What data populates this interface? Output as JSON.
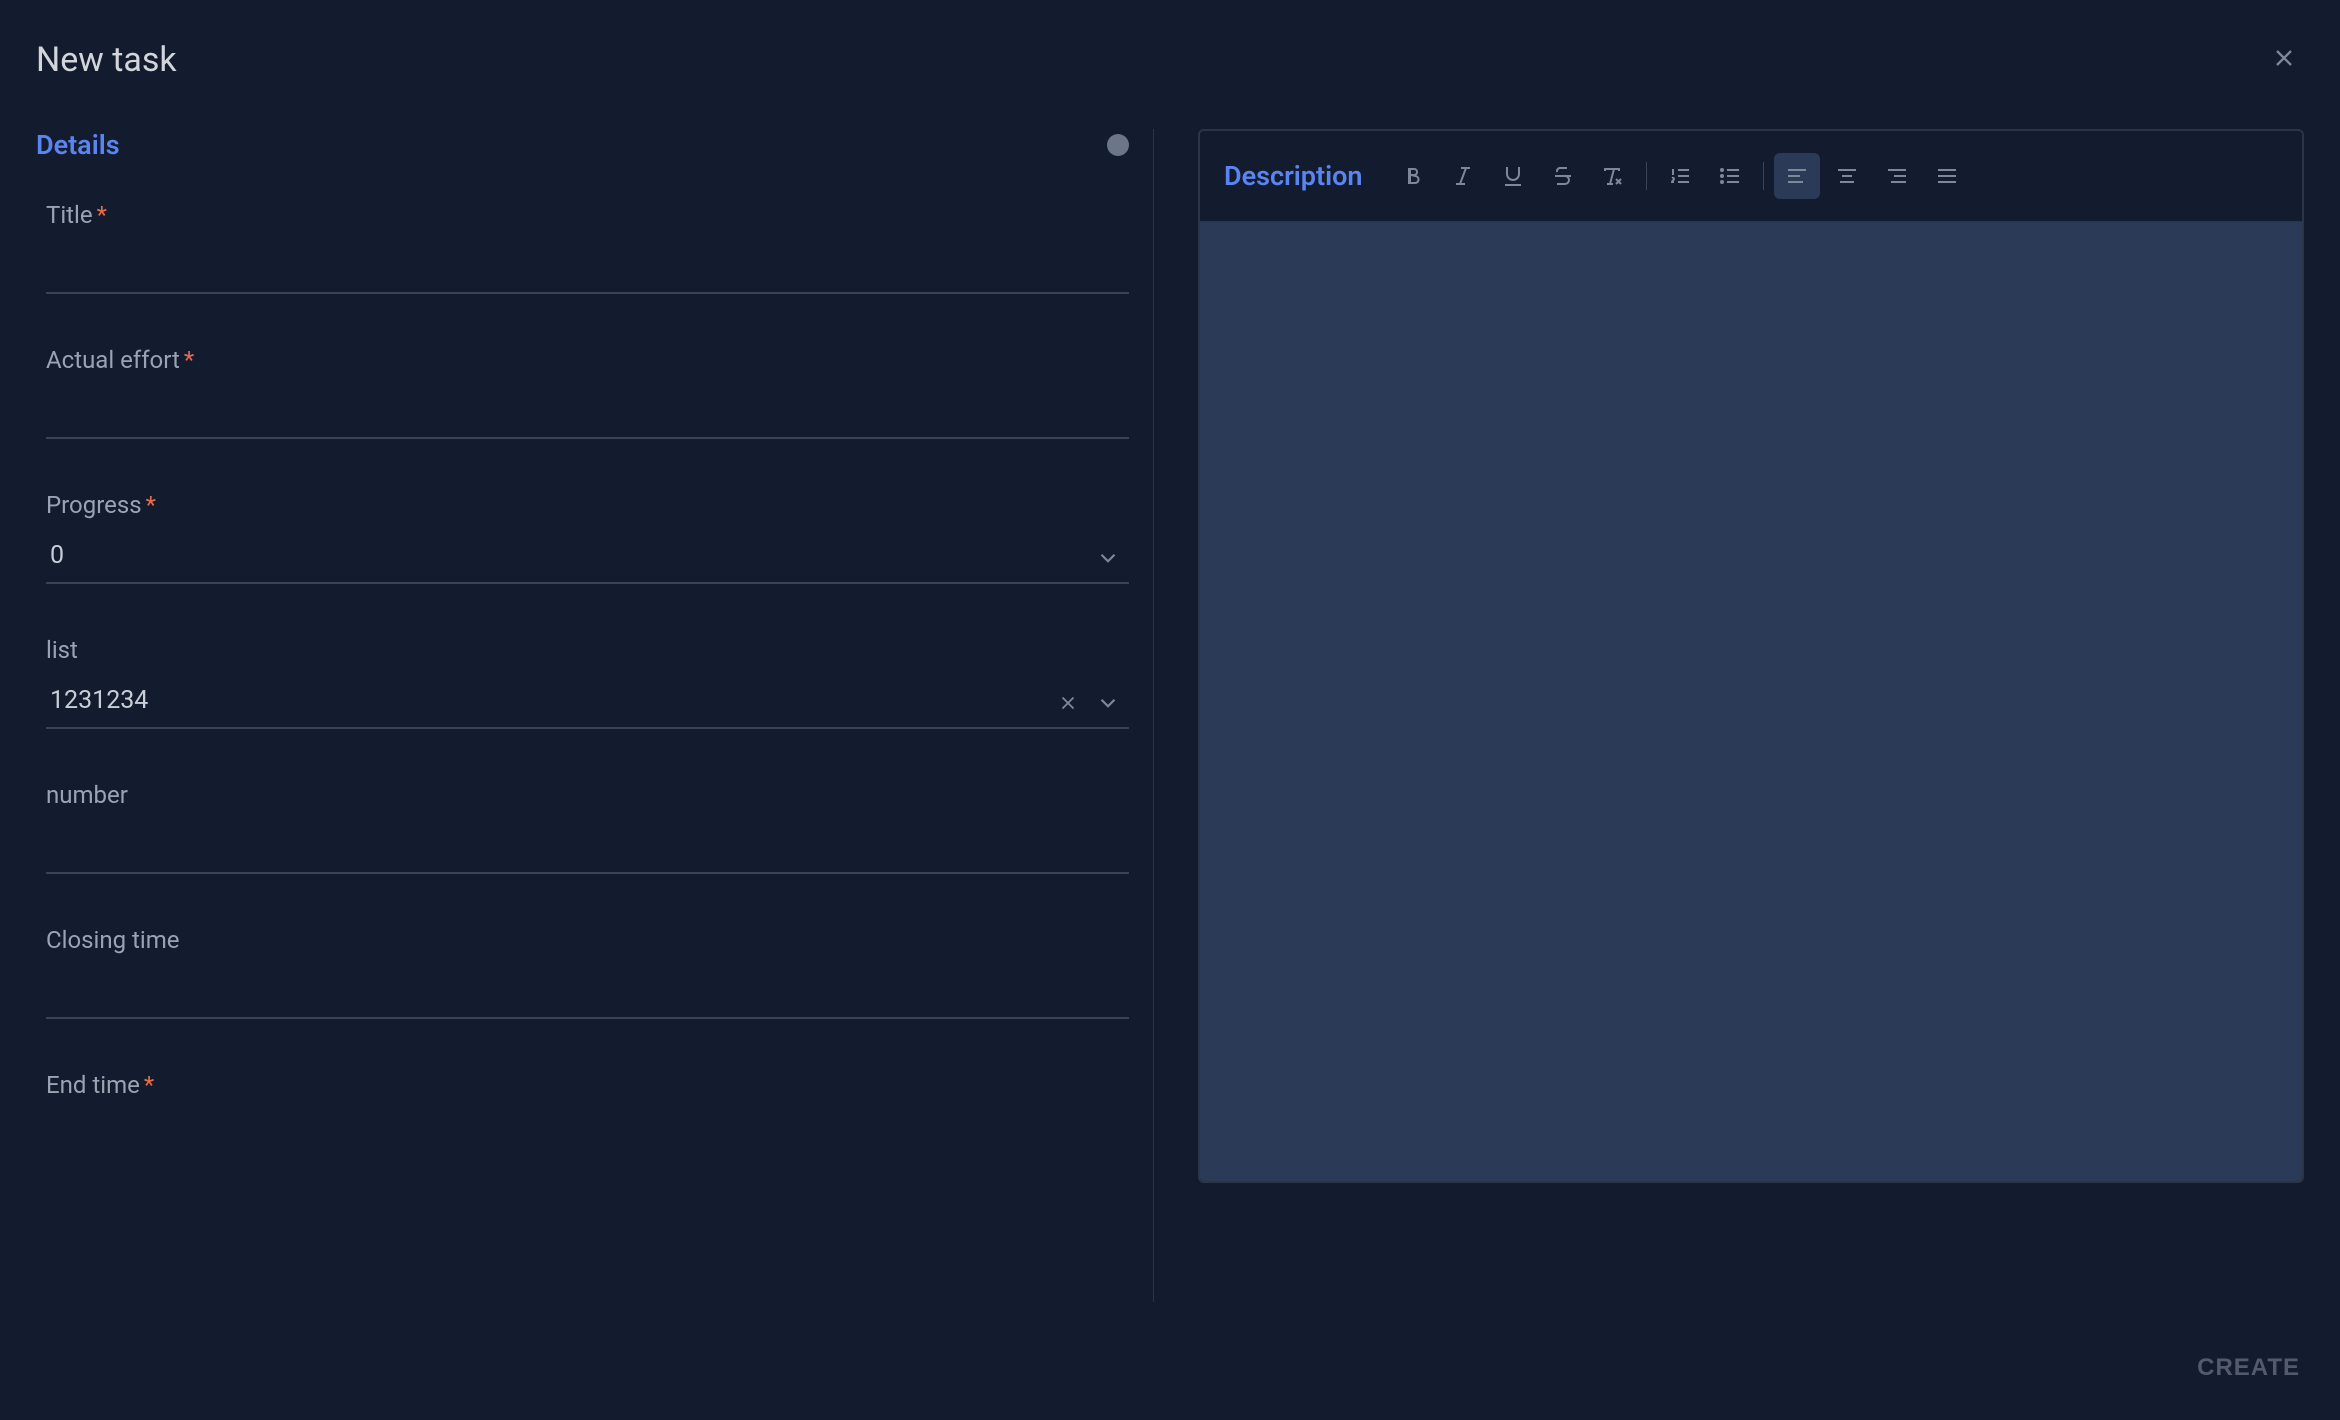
{
  "header": {
    "title": "New task"
  },
  "left": {
    "section_title": "Details",
    "fields": {
      "title": {
        "label": "Title",
        "required": true,
        "value": ""
      },
      "actual_effort": {
        "label": "Actual effort",
        "required": true,
        "value": ""
      },
      "progress": {
        "label": "Progress",
        "required": true,
        "value": "0"
      },
      "list": {
        "label": "list",
        "required": false,
        "value": "1231234"
      },
      "number": {
        "label": "number",
        "required": false,
        "value": ""
      },
      "closing_time": {
        "label": "Closing time",
        "required": false,
        "value": ""
      },
      "end_time": {
        "label": "End time",
        "required": true,
        "value": ""
      }
    }
  },
  "right": {
    "title": "Description",
    "toolbar": {
      "bold": "bold",
      "italic": "italic",
      "underline": "underline",
      "strike": "strikethrough",
      "clear": "clear-format",
      "ol": "ordered-list",
      "ul": "unordered-list",
      "align_left": "align-left",
      "align_center": "align-center",
      "align_right": "align-right",
      "align_justify": "align-justify",
      "active": "align_left"
    },
    "content": ""
  },
  "footer": {
    "create_label": "CREATE"
  }
}
